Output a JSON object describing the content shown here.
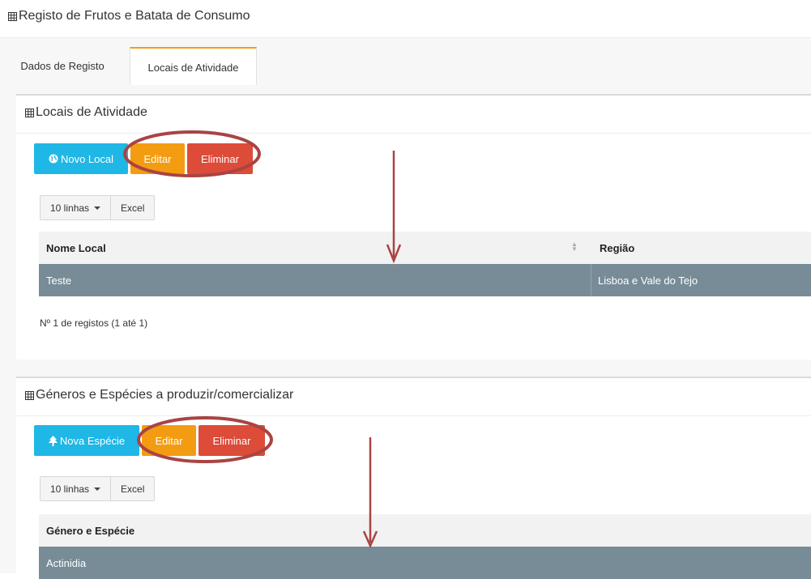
{
  "page": {
    "title": "Registo de Frutos e Batata de Consumo"
  },
  "tabs": [
    {
      "label": "Dados de Registo",
      "active": false
    },
    {
      "label": "Locais de Atividade",
      "active": true
    }
  ],
  "locais": {
    "title": "Locais de Atividade",
    "buttons": {
      "new": "Novo Local",
      "edit": "Editar",
      "delete": "Eliminar"
    },
    "toolbar": {
      "rows": "10 linhas",
      "excel": "Excel"
    },
    "columns": [
      "Nome Local",
      "Região"
    ],
    "rows": [
      {
        "nome": "Teste",
        "regiao": "Lisboa e Vale do Tejo"
      }
    ],
    "info": "Nº 1 de registos (1 até 1)"
  },
  "especies": {
    "title": "Géneros e Espécies a produzir/comercializar",
    "buttons": {
      "new": "Nova Espécie",
      "edit": "Editar",
      "delete": "Eliminar"
    },
    "toolbar": {
      "rows": "10 linhas",
      "excel": "Excel"
    },
    "columns": [
      "Género e Espécie"
    ],
    "rows": [
      {
        "nome": "Actinidia"
      }
    ]
  },
  "colors": {
    "info": "#1fb7e6",
    "warning": "#f39c12",
    "danger": "#dd4b39",
    "selected_row": "#778c97",
    "annotation": "#a94442"
  },
  "icons": [
    "table-grid-icon",
    "globe-icon",
    "tree-icon",
    "sort-icon",
    "caret-down-icon"
  ]
}
